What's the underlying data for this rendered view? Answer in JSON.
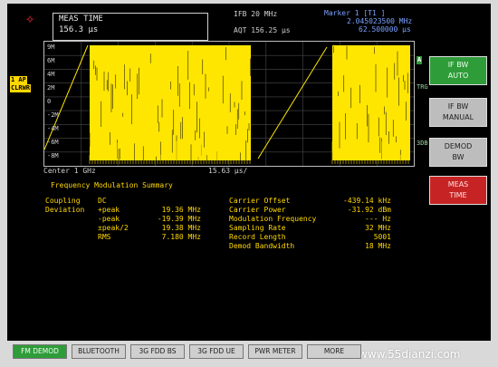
{
  "header": {
    "logo": "⟡",
    "meas_title": "MEAS TIME",
    "meas_value": "156.3 µs",
    "ifbw": "IFB 20 MHz",
    "aqt": "AQT 156.25 µs",
    "marker_title": "Marker 1 [T1 ]",
    "marker_freq": "2.045023500 MHz",
    "marker_time": "62.500000 µs"
  },
  "side_tags": {
    "one_ap": "1 AP",
    "clrwr": "CLRWR",
    "a": "A",
    "trg": "TRG",
    "three_db": "3DB"
  },
  "plot": {
    "y_labels": [
      "9M",
      "6M",
      "4M",
      "2M",
      "0",
      "-2M",
      "-4M",
      "-6M",
      "-8M"
    ],
    "center": "Center 1 GHz",
    "div": "15.63 µs/"
  },
  "summary": {
    "title": "Frequency Modulation Summary",
    "coupling_label": "Coupling",
    "coupling_value": "DC",
    "deviation_label": "Deviation",
    "dev_rows": [
      {
        "name": "+peak",
        "value": "19.36 MHz"
      },
      {
        "name": "-peak",
        "value": "-19.39 MHz"
      },
      {
        "name": "±peak/2",
        "value": "19.38 MHz"
      },
      {
        "name": "RMS",
        "value": "7.180 MHz"
      }
    ],
    "right_rows": [
      {
        "name": "Carrier Offset",
        "value": "-439.14 kHz"
      },
      {
        "name": "Carrier Power",
        "value": "-31.92 dBm"
      },
      {
        "name": "Modulation Frequency",
        "value": "--- Hz"
      },
      {
        "name": "Sampling Rate",
        "value": "32 MHz"
      },
      {
        "name": "Record Length",
        "value": "5001"
      },
      {
        "name": "Demod Bandwidth",
        "value": "18 MHz"
      }
    ]
  },
  "softkeys": [
    {
      "line1": "IF BW",
      "line2": "AUTO",
      "style": "green"
    },
    {
      "line1": "IF BW",
      "line2": "MANUAL",
      "style": "grey"
    },
    {
      "line1": "DEMOD",
      "line2": "BW",
      "style": "grey"
    },
    {
      "line1": "MEAS",
      "line2": "TIME",
      "style": "red"
    }
  ],
  "fkeys": [
    "FM DEMOD",
    "BLUETOOTH",
    "3G FDD BS",
    "3G FDD UE",
    "PWR METER",
    "MORE"
  ],
  "watermark": "www.55dianzi.com",
  "colors": {
    "trace": "#ffe600",
    "line": "#ffd800"
  }
}
